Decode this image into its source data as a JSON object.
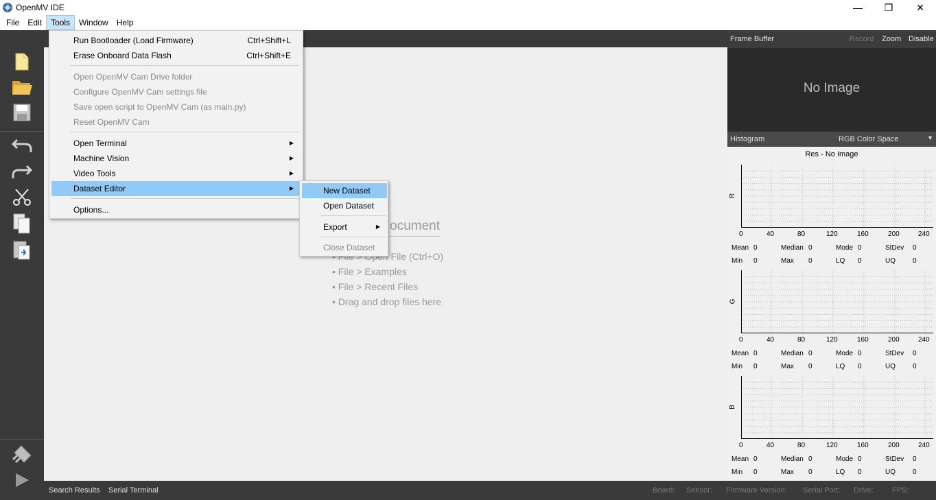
{
  "window": {
    "title": "OpenMV IDE",
    "minimize": "—",
    "maximize": "❐",
    "close": "✕"
  },
  "menubar": [
    "File",
    "Edit",
    "Tools",
    "Window",
    "Help"
  ],
  "tools_menu": {
    "items": [
      {
        "label": "Run Bootloader (Load Firmware)",
        "shortcut": "Ctrl+Shift+L"
      },
      {
        "label": "Erase Onboard Data Flash",
        "shortcut": "Ctrl+Shift+E"
      },
      {
        "label": "Open OpenMV Cam Drive folder"
      },
      {
        "label": "Configure OpenMV Cam settings file"
      },
      {
        "label": "Save open script to OpenMV Cam (as main.py)"
      },
      {
        "label": "Reset OpenMV Cam"
      },
      {
        "label": "Open Terminal"
      },
      {
        "label": "Machine Vision"
      },
      {
        "label": "Video Tools"
      },
      {
        "label": "Dataset Editor"
      },
      {
        "label": "Options..."
      }
    ]
  },
  "dataset_menu": {
    "items": [
      "New Dataset",
      "Open Dataset",
      "Export",
      "Close Dataset"
    ]
  },
  "editor": {
    "title_fragment": "ocument",
    "hints": [
      "• File > Open File (Ctrl+O)",
      "• File > Examples",
      "• File > Recent Files",
      "• Drag and drop files here"
    ]
  },
  "frame_buffer": {
    "label": "Frame Buffer",
    "record": "Record",
    "zoom": "Zoom",
    "disable": "Disable",
    "no_image": "No Image"
  },
  "histogram": {
    "label": "Histogram",
    "color_space": "RGB Color Space",
    "res": "Res - No Image",
    "ticks": [
      "0",
      "40",
      "80",
      "120",
      "160",
      "200",
      "240"
    ],
    "channels": [
      {
        "name": "R",
        "mean": "Mean",
        "mean_v": "0",
        "median": "Median",
        "median_v": "0",
        "mode": "Mode",
        "mode_v": "0",
        "stdev": "StDev",
        "stdev_v": "0",
        "min": "Min",
        "min_v": "0",
        "max": "Max",
        "max_v": "0",
        "lq": "LQ",
        "lq_v": "0",
        "uq": "UQ",
        "uq_v": "0"
      },
      {
        "name": "G",
        "mean": "Mean",
        "mean_v": "0",
        "median": "Median",
        "median_v": "0",
        "mode": "Mode",
        "mode_v": "0",
        "stdev": "StDev",
        "stdev_v": "0",
        "min": "Min",
        "min_v": "0",
        "max": "Max",
        "max_v": "0",
        "lq": "LQ",
        "lq_v": "0",
        "uq": "UQ",
        "uq_v": "0"
      },
      {
        "name": "B",
        "mean": "Mean",
        "mean_v": "0",
        "median": "Median",
        "median_v": "0",
        "mode": "Mode",
        "mode_v": "0",
        "stdev": "StDev",
        "stdev_v": "0",
        "min": "Min",
        "min_v": "0",
        "max": "Max",
        "max_v": "0",
        "lq": "LQ",
        "lq_v": "0",
        "uq": "UQ",
        "uq_v": "0"
      }
    ]
  },
  "statusbar": {
    "search_results": "Search Results",
    "serial_terminal": "Serial Terminal",
    "board": "Board:",
    "sensor": "Sensor:",
    "firmware": "Firmware Version:",
    "serial_port": "Serial Port:",
    "drive": "Drive:",
    "fps": "FPS:"
  },
  "colors": {
    "toolbar_bg": "#3a3a3a",
    "menu_highlight": "#91c9f7",
    "menubar_active": "#cce4f7"
  }
}
